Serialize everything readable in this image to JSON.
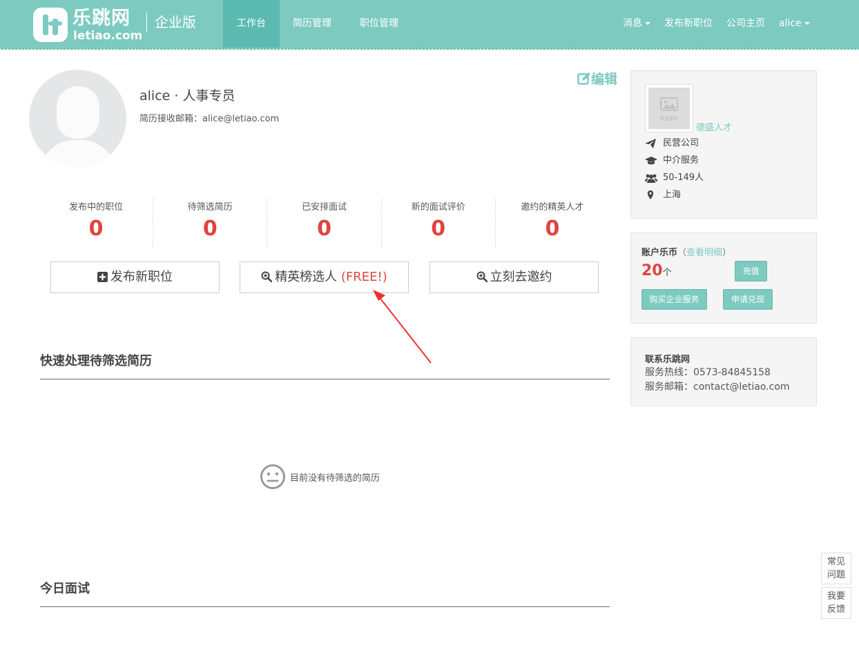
{
  "header": {
    "logo_name": "乐跳网",
    "logo_domain": "letiao.com",
    "edition": "企业版",
    "nav": [
      {
        "label": "工作台"
      },
      {
        "label": "简历管理"
      },
      {
        "label": "职位管理"
      }
    ],
    "right_nav": {
      "messages": "消息",
      "post_job": "发布新职位",
      "company_home": "公司主页",
      "user": "alice"
    }
  },
  "profile": {
    "name_title": "alice · 人事专员",
    "email_label": "简历接收邮箱",
    "email": "alice@letiao.com",
    "edit_label": "编辑"
  },
  "stats": [
    {
      "label": "发布中的职位",
      "value": "0"
    },
    {
      "label": "待筛选简历",
      "value": "0"
    },
    {
      "label": "已安排面试",
      "value": "0"
    },
    {
      "label": "新的面试评价",
      "value": "0"
    },
    {
      "label": "邀约的精英人才",
      "value": "0"
    }
  ],
  "actions": {
    "post_job": "发布新职位",
    "elite_pick": "精英榜选人",
    "elite_free": "(FREE!)",
    "invite": "立刻去邀约"
  },
  "sections": {
    "pending_title": "快速处理待筛选简历",
    "empty_text": "目前没有待筛选的简历",
    "today_title": "今日面试"
  },
  "company": {
    "logo_caption": "暂无图片",
    "name": "德盛人才",
    "type": "民营公司",
    "industry": "中介服务",
    "size": "50-149人",
    "city": "上海"
  },
  "account": {
    "label": "账户乐币",
    "paren_open": "（",
    "detail_link": "查看明细",
    "paren_close": "）",
    "coins": "20",
    "unit": "个",
    "recharge": "充值",
    "buy_service": "购买企业服务",
    "withdraw": "申请兑现"
  },
  "contact": {
    "title": "联系乐跳网",
    "hotline_label": "服务热线",
    "hotline": "0573-84845158",
    "email_label": "服务邮箱",
    "email": "contact@letiao.com"
  },
  "floating": {
    "faq_line1": "常见",
    "faq_line2": "问题",
    "feedback_line1": "我要",
    "feedback_line2": "反馈"
  },
  "colors": {
    "brand": "#7ccac0",
    "brand_dark": "#5cbbb0",
    "accent_red": "#e0443d"
  }
}
